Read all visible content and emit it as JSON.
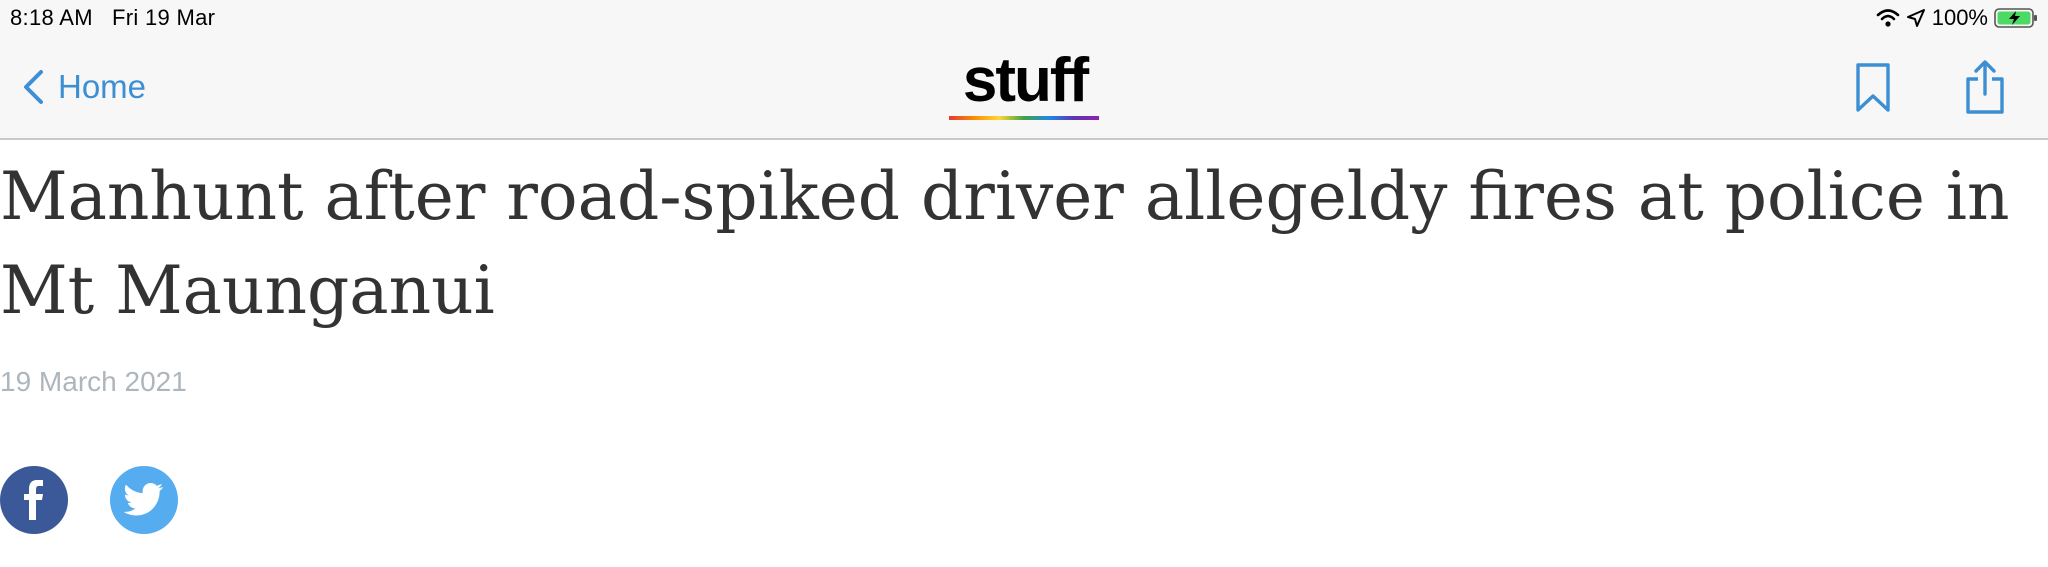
{
  "status_bar": {
    "time_date": "8:18 AM   Fri 19 Mar",
    "battery": "100%",
    "icons": [
      "wifi-icon",
      "location-arrow-icon",
      "battery-charging-icon"
    ]
  },
  "nav": {
    "back_label": "Home",
    "back_icon": "chevron-left-icon",
    "logo_text": "stuff",
    "bookmark_icon": "bookmark-icon",
    "share_icon": "share-icon",
    "accent_color": "#3d8fd4"
  },
  "article": {
    "headline": "Manhunt after road-spiked driver allegeldy fires at police in Mt Maunganui",
    "date": "19 March 2021"
  },
  "social": {
    "facebook": {
      "icon": "facebook-icon",
      "color": "#3b5998"
    },
    "twitter": {
      "icon": "twitter-icon",
      "color": "#55acee"
    }
  }
}
